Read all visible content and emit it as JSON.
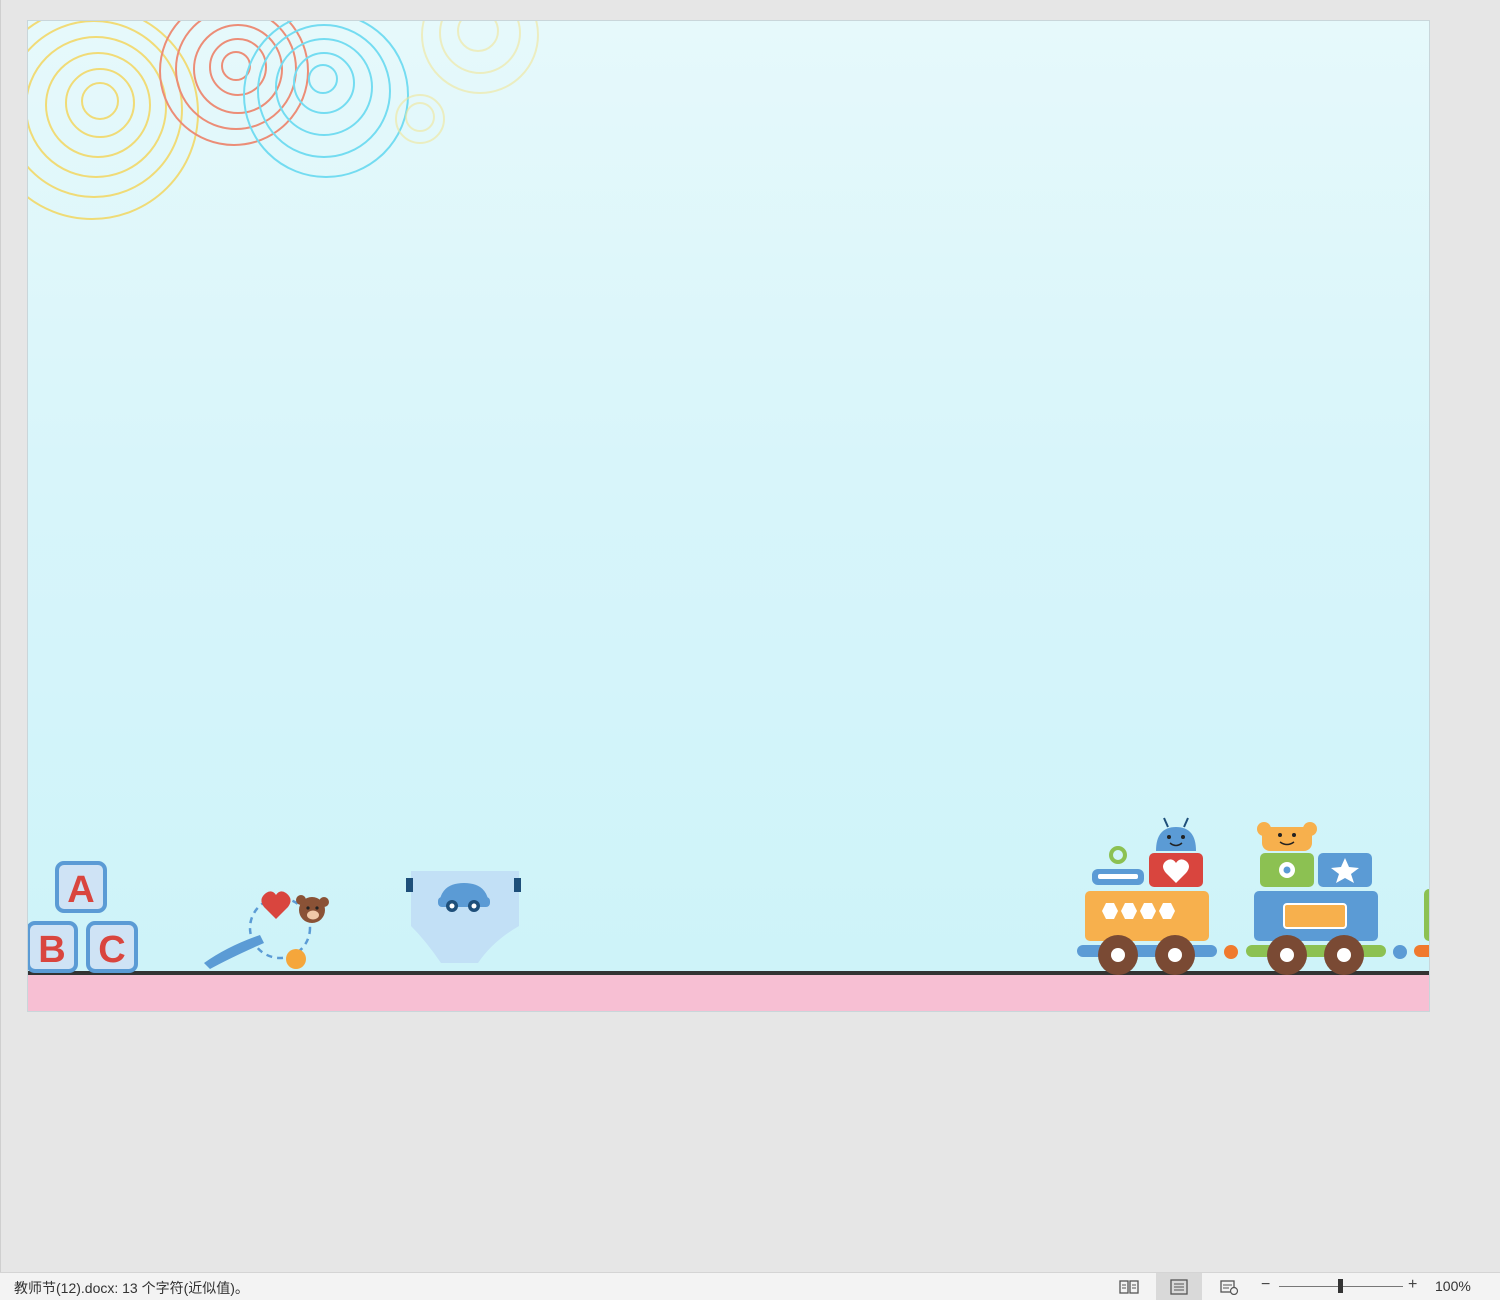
{
  "document": {
    "blocks": [
      "A",
      "B",
      "C"
    ]
  },
  "statusbar": {
    "text": "教师节(12).docx: 13 个字符(近似值)。",
    "zoom_minus": "−",
    "zoom_plus": "+",
    "zoom_label": "100%",
    "zoom_value": 100,
    "views": [
      "read-mode-icon",
      "print-layout-icon",
      "web-layout-icon"
    ],
    "active_view": "print-layout-icon"
  },
  "colors": {
    "page_bg": "#d6f5fa",
    "ground": "#f7bfd3",
    "block_border": "#5b9bd5",
    "block_letter": "#d9453e"
  }
}
